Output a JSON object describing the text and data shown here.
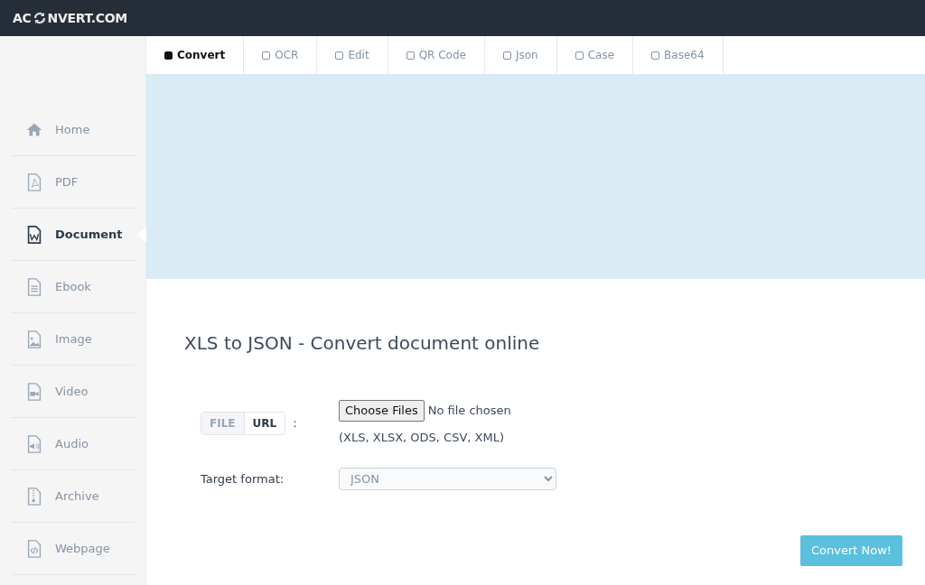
{
  "header": {
    "logo_left": "AC",
    "logo_right": "NVERT.COM"
  },
  "tabs": [
    {
      "label": "Convert",
      "selected": true
    },
    {
      "label": "OCR",
      "selected": false
    },
    {
      "label": "Edit",
      "selected": false
    },
    {
      "label": "QR Code",
      "selected": false
    },
    {
      "label": "Json",
      "selected": false
    },
    {
      "label": "Case",
      "selected": false
    },
    {
      "label": "Base64",
      "selected": false
    }
  ],
  "sidebar": {
    "items": [
      {
        "label": "Home",
        "selected": false
      },
      {
        "label": "PDF",
        "selected": false
      },
      {
        "label": "Document",
        "selected": true
      },
      {
        "label": "Ebook",
        "selected": false
      },
      {
        "label": "Image",
        "selected": false
      },
      {
        "label": "Video",
        "selected": false
      },
      {
        "label": "Audio",
        "selected": false
      },
      {
        "label": "Archive",
        "selected": false
      },
      {
        "label": "Webpage",
        "selected": false
      }
    ]
  },
  "main": {
    "title": "XLS to JSON - Convert document online",
    "source_toggle": [
      {
        "label": "FILE",
        "selected": false
      },
      {
        "label": "URL",
        "selected": true
      }
    ],
    "source_colon": ":",
    "file_button": "Choose Files",
    "file_status": "No file chosen",
    "formats_hint": "(XLS, XLSX, ODS, CSV, XML)",
    "target_label": "Target format:",
    "target_value": "JSON",
    "convert_button": "Convert Now!"
  }
}
